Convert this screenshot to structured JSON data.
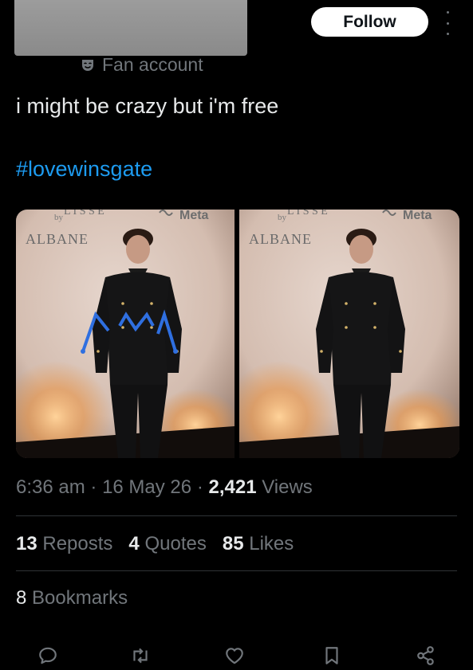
{
  "header": {
    "follow_label": "Follow",
    "account_label": "Fan account"
  },
  "tweet": {
    "text": "i might be crazy but i'm free",
    "hashtag": "#lovewinsgate"
  },
  "media": {
    "left": {
      "sign_line1": "by",
      "sign_line2": "ALBANE",
      "sponsor": "Meta"
    },
    "right": {
      "sign_line1": "by",
      "sign_line2": "ALBANE",
      "sponsor": "Meta"
    }
  },
  "meta": {
    "time": "6:36 am",
    "date": "16 May 26",
    "views_count": "2,421",
    "views_label": "Views",
    "separator": "·"
  },
  "stats": {
    "reposts_count": "13",
    "reposts_label": "Reposts",
    "quotes_count": "4",
    "quotes_label": "Quotes",
    "likes_count": "85",
    "likes_label": "Likes",
    "bookmarks_count": "8",
    "bookmarks_label": "Bookmarks"
  },
  "colors": {
    "background": "#000000",
    "text_primary": "#e7e9ea",
    "text_secondary": "#71767b",
    "link": "#1d9bf0",
    "divider": "#2f3336",
    "annotation_blue": "#2f6fe0"
  },
  "actions": [
    "reply-icon",
    "repost-icon",
    "like-icon",
    "bookmark-icon",
    "share-icon"
  ]
}
